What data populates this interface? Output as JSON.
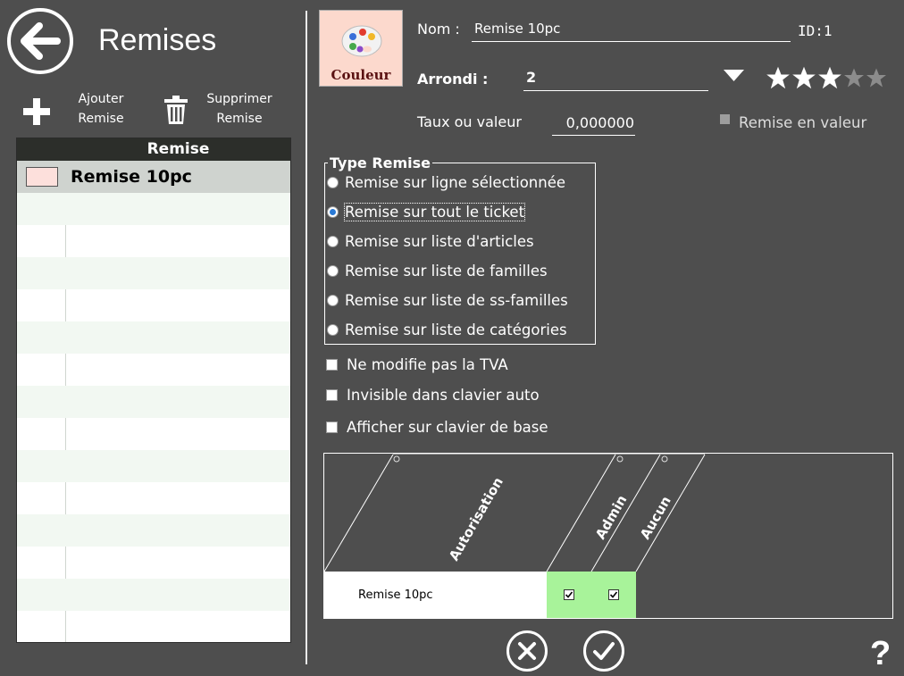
{
  "header": {
    "title": "Remises",
    "back_icon": "arrow-left-icon"
  },
  "toolbar": {
    "add": {
      "line1": "Ajouter",
      "line2": "Remise",
      "icon": "plus-icon"
    },
    "delete": {
      "line1": "Supprimer",
      "line2": "Remise",
      "icon": "trash-icon"
    }
  },
  "list": {
    "header": "Remise",
    "items": [
      {
        "label": "Remise 10pc",
        "color": "#fde0dc"
      }
    ]
  },
  "form": {
    "color_button": {
      "label": "Couleur",
      "icon": "palette-icon"
    },
    "name_label": "Nom :",
    "name_value": "Remise 10pc",
    "id_label": "ID:1",
    "arrondi_label": "Arrondi :",
    "arrondi_value": "2",
    "rating": 3,
    "rating_max": 5,
    "taux_label": "Taux ou valeur",
    "taux_value": "0,000000",
    "remise_en_valeur": "Remise en valeur"
  },
  "type_remise": {
    "title": "Type Remise",
    "options": [
      "Remise sur ligne sélectionnée",
      "Remise sur tout le ticket",
      "Remise sur liste d'articles",
      "Remise sur liste de familles",
      "Remise sur liste de ss-familles",
      "Remise sur liste de catégories"
    ],
    "selected_index": 1
  },
  "checkboxes": {
    "tva": "Ne modifie pas la TVA",
    "invisible": "Invisible dans clavier auto",
    "afficher": "Afficher sur clavier de base"
  },
  "auth_grid": {
    "header": "Autorisation",
    "columns": [
      "Admin",
      "Aucun"
    ],
    "rows": [
      {
        "label": "Remise 10pc",
        "checks": [
          true,
          true
        ]
      }
    ]
  },
  "actions": {
    "cancel_icon": "cancel-icon",
    "ok_icon": "check-icon",
    "help": "?"
  },
  "colors": {
    "background": "#4e4e4e",
    "check_cell": "#a8f39a",
    "radio_accent": "#2a7ad6"
  }
}
